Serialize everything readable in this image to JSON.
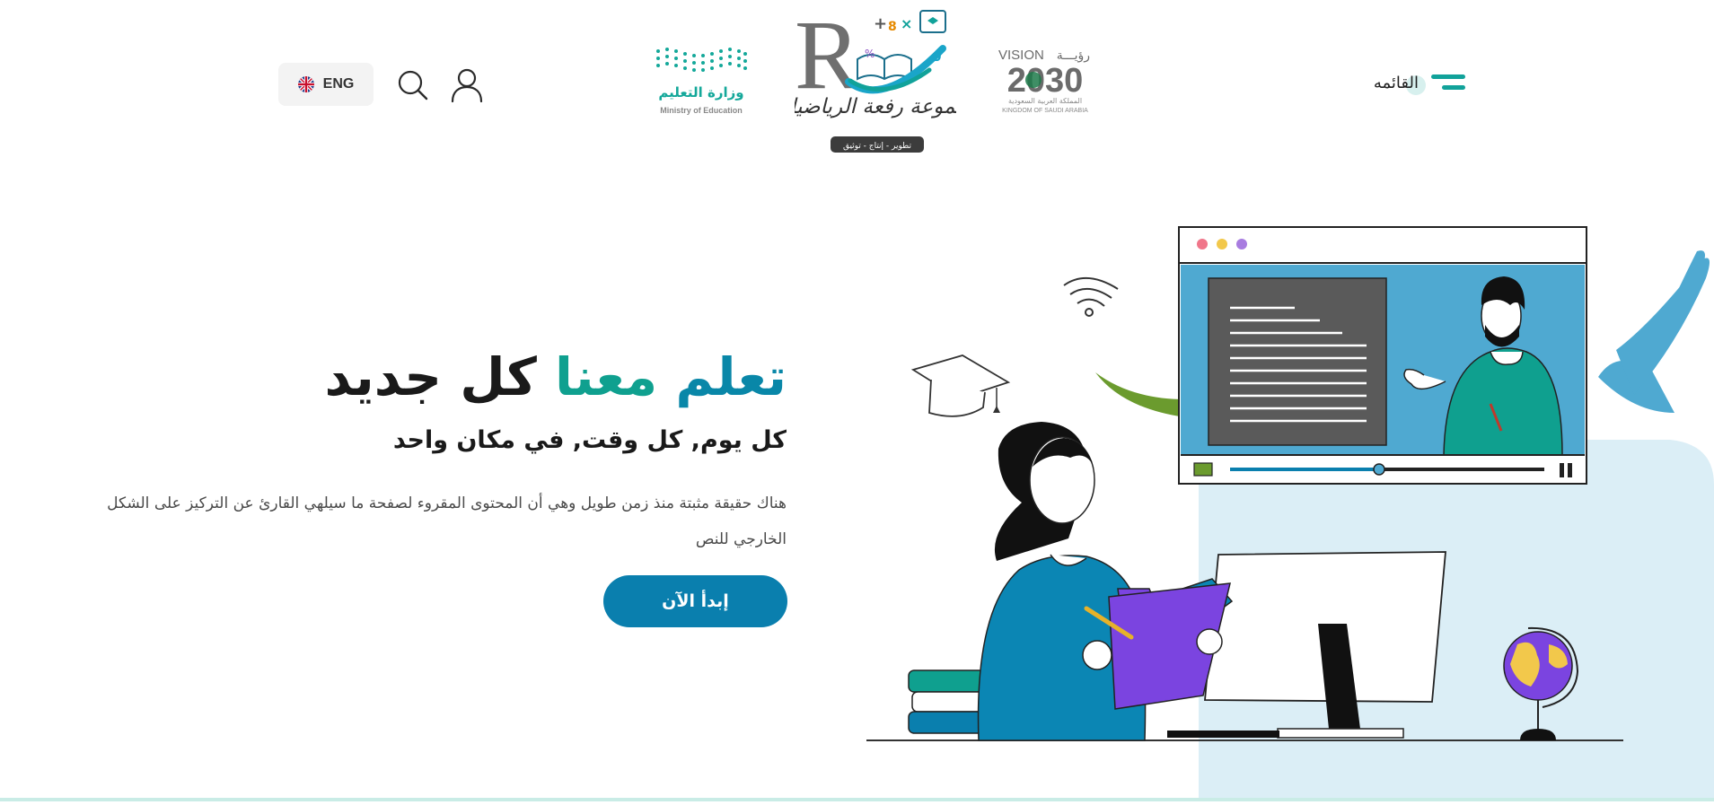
{
  "header": {
    "language_button": {
      "label": "ENG",
      "icon": "uk-flag-icon"
    },
    "search_icon": "search-icon",
    "user_icon": "user-icon",
    "ministry_logo": {
      "arabic": "وزارة التعليم",
      "english": "Ministry of Education"
    },
    "brand_logo": {
      "name": "مجموعة رفعة الرياضيات",
      "tagline": "تطوير - إنتاج - توثيق"
    },
    "vision_logo": {
      "vision_text": "VISION",
      "arabic_vision": "رؤيـــة",
      "year": "2030",
      "kingdom_arabic": "المملكة العربية السعودية",
      "kingdom_english": "KINGDOM OF SAUDI ARABIA"
    },
    "menu": {
      "label": "القائمه",
      "icon": "hamburger-icon"
    }
  },
  "hero": {
    "title_part1": "تعلم",
    "title_part2": "معنا",
    "title_part3": "كل جديد",
    "subtitle": "كل يوم, كل وقت, في مكان واحد",
    "description": "هناك حقيقة مثبتة منذ زمن طويل وهي أن المحتوى المقروء لصفحة ما سيلهي القارئ عن التركيز على الشكل الخارجي للنص",
    "cta_label": "إبدأ الآن"
  },
  "colors": {
    "primary_blue": "#0a7fae",
    "teal": "#0fa08f",
    "dark_text": "#1a1a1a",
    "light_blue_bg": "#dbeef6",
    "screen_blue": "#4fa9d1",
    "purple": "#7b44e0",
    "green": "#6b9b2e"
  }
}
